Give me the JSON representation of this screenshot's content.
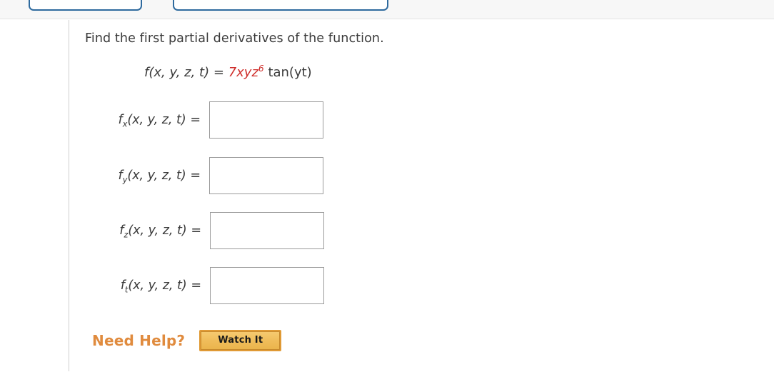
{
  "toolbar": {
    "tabs": [
      {
        "label": "",
        "name": "toolbar-button-left"
      },
      {
        "label": "",
        "name": "toolbar-button-right"
      }
    ]
  },
  "question": {
    "prompt": "Find the first partial derivatives of the function.",
    "formula": {
      "lhs": "f(x, y, z, t)",
      "equals": "=",
      "coefficient_term": "7xyz",
      "exponent": "6",
      "trig": "tan(yt)",
      "coefficient_color": "#cf2f2c"
    }
  },
  "answers": [
    {
      "label_function": "f",
      "label_subscript": "x",
      "label_args": "(x, y, z, t)",
      "equals": "=",
      "value": "",
      "placeholder": ""
    },
    {
      "label_function": "f",
      "label_subscript": "y",
      "label_args": "(x, y, z, t)",
      "equals": "=",
      "value": "",
      "placeholder": ""
    },
    {
      "label_function": "f",
      "label_subscript": "z",
      "label_args": "(x, y, z, t)",
      "equals": "=",
      "value": "",
      "placeholder": ""
    },
    {
      "label_function": "f",
      "label_subscript": "t",
      "label_args": "(x, y, z, t)",
      "equals": "=",
      "value": "",
      "placeholder": ""
    }
  ],
  "help": {
    "heading": "Need Help?",
    "watch_button_label": "Watch It",
    "heading_color": "#e08b3e"
  }
}
